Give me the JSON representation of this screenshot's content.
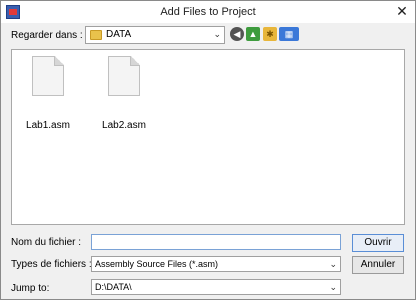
{
  "window": {
    "title": "Add Files to Project",
    "close_glyph": "✕"
  },
  "lookin": {
    "label": "Regarder dans :",
    "value": "DATA"
  },
  "files": [
    {
      "name": "Lab1.asm"
    },
    {
      "name": "Lab2.asm"
    }
  ],
  "filename": {
    "label": "Nom du fichier :",
    "value": ""
  },
  "filetype": {
    "label": "Types de fichiers :",
    "value": "Assembly Source Files (*.asm)"
  },
  "jumpto": {
    "label": "Jump to:",
    "value": "D:\\DATA\\"
  },
  "buttons": {
    "open": "Ouvrir",
    "cancel": "Annuler"
  },
  "icons": {
    "chevron": "⌄"
  }
}
